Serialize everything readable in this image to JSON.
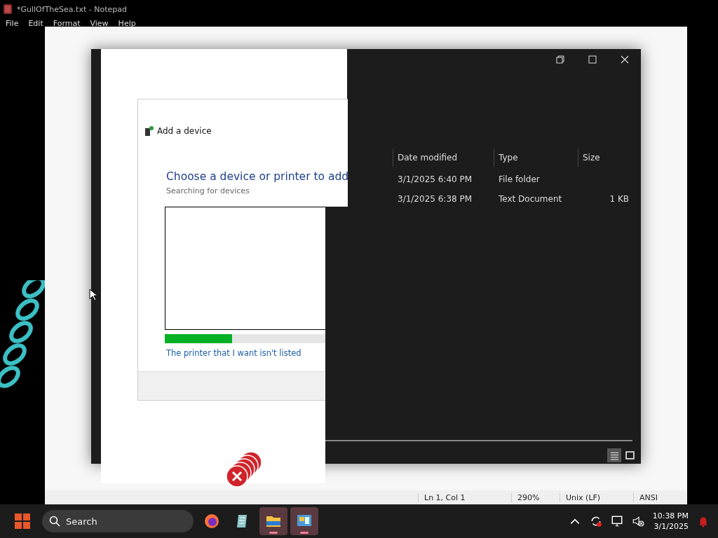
{
  "notepad": {
    "title": "*GullOfTheSea.txt - Notepad",
    "menu": [
      "File",
      "Edit",
      "Format",
      "View",
      "Help"
    ],
    "status_bar": [
      "Ln 1, Col 1",
      "290%",
      "Unix (LF)",
      "ANSI"
    ]
  },
  "explorer": {
    "columns": [
      "Date modified",
      "Type",
      "Size"
    ],
    "rows": [
      [
        "3/1/2025 6:40 PM",
        "File folder"
      ],
      [
        "3/1/2025 6:38 PM",
        "Text Document",
        "1 KB"
      ]
    ],
    "view_buttons": [
      {
        "kind": "details",
        "selected": true
      },
      {
        "kind": "tiles",
        "selected": false
      }
    ]
  },
  "dialog": {
    "title": "Add a device",
    "heading": "Choose a device or printer to add",
    "status": "Searching for devices",
    "progress": {
      "level": 0.42
    },
    "link": "The printer that I want isn't listed"
  },
  "taskbar": {
    "search_placeholder": "Search",
    "apps": [
      {
        "kind": "firefox",
        "active": false
      },
      {
        "kind": "notes",
        "active": false
      },
      {
        "kind": "folder",
        "active": true
      },
      {
        "kind": "control",
        "active": true
      }
    ],
    "time": "10:38 PM",
    "date": "3/1/2025"
  }
}
